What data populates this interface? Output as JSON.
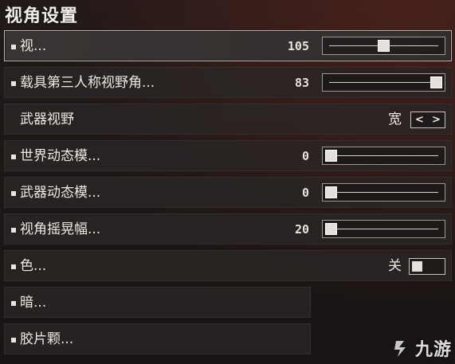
{
  "title": "视角设置",
  "rows": [
    {
      "label": "视...",
      "value": "105",
      "slider_fraction": 0.5
    },
    {
      "label": "载具第三人称视野角...",
      "value": "83",
      "slider_fraction": 1.0
    },
    {
      "label": "武器视野",
      "option_value": "宽"
    },
    {
      "label": "世界动态模...",
      "value": "0",
      "slider_fraction": 0.0
    },
    {
      "label": "武器动态模...",
      "value": "0",
      "slider_fraction": 0.0
    },
    {
      "label": "视角摇晃幅...",
      "value": "20",
      "slider_fraction": 0.0
    },
    {
      "label": "色...",
      "option_value": "关",
      "toggle_on": false
    },
    {
      "label": "暗..."
    },
    {
      "label": "胶片颗..."
    }
  ],
  "arrows": {
    "left": "<",
    "right": ">"
  },
  "watermark": {
    "text": "九游",
    "icon": "jiuyou-logo-icon"
  },
  "colors": {
    "background": "#1c1717",
    "row": "#2a2625",
    "selected_border": "#b7b2ad",
    "text": "#ece8e4"
  }
}
